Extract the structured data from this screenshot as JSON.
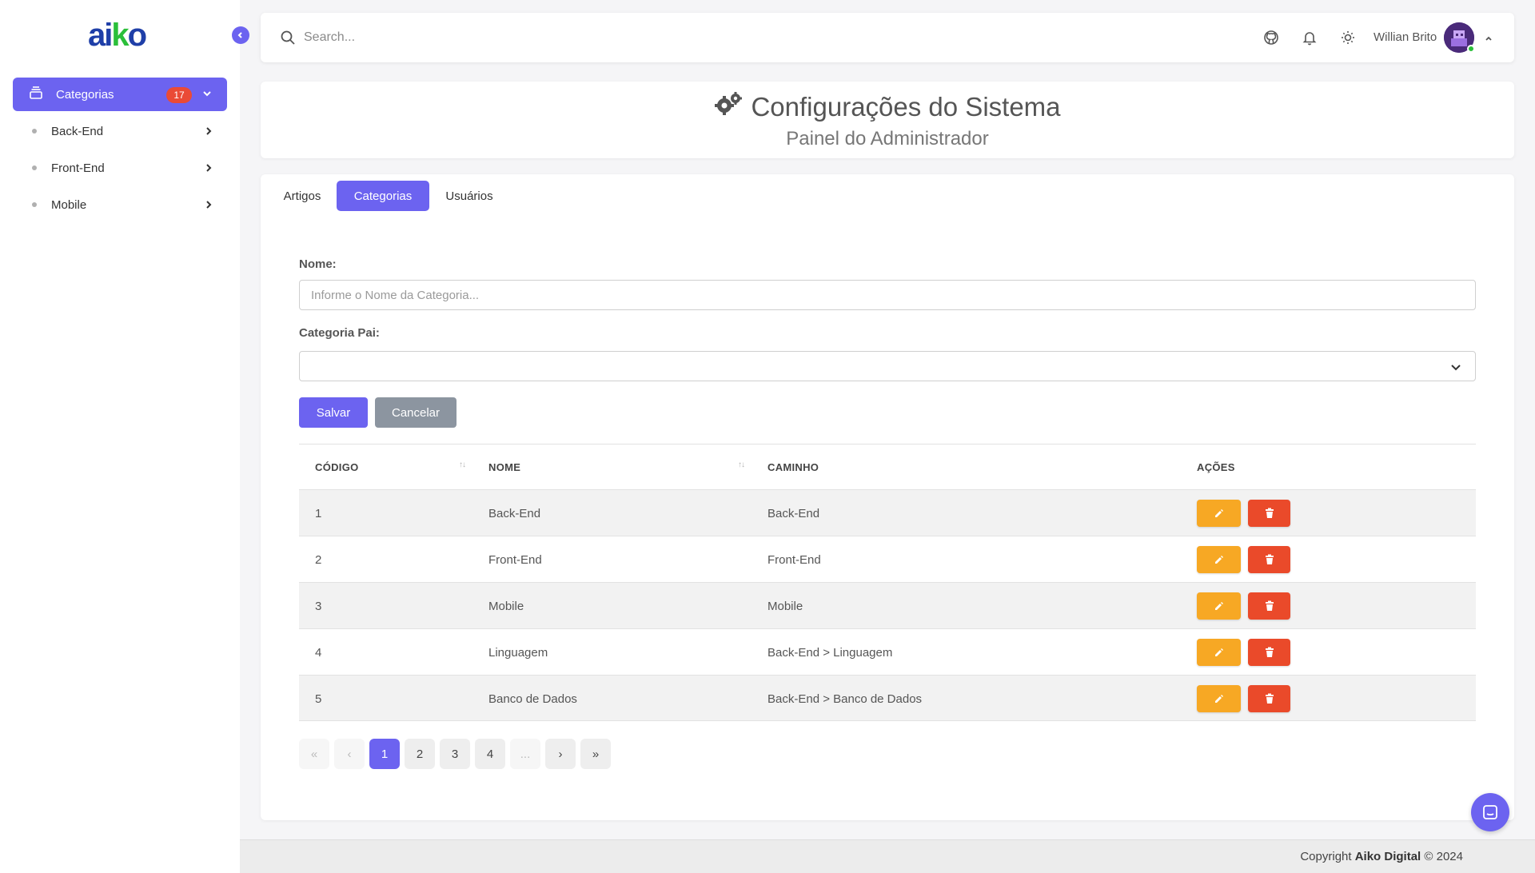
{
  "sidebar": {
    "logo_text": "aiko",
    "active_item": {
      "label": "Categorias",
      "badge": "17"
    },
    "items": [
      {
        "label": "Back-End"
      },
      {
        "label": "Front-End"
      },
      {
        "label": "Mobile"
      }
    ]
  },
  "topbar": {
    "search_placeholder": "Search...",
    "user_name": "Willian Brito"
  },
  "header": {
    "title": "Configurações do Sistema",
    "subtitle": "Painel do Administrador"
  },
  "tabs": [
    {
      "label": "Artigos",
      "active": false
    },
    {
      "label": "Categorias",
      "active": true
    },
    {
      "label": "Usuários",
      "active": false
    }
  ],
  "form": {
    "name_label": "Nome:",
    "name_placeholder": "Informe o Nome da Categoria...",
    "name_value": "",
    "parent_label": "Categoria Pai:",
    "parent_value": "",
    "save_label": "Salvar",
    "cancel_label": "Cancelar"
  },
  "table": {
    "headers": [
      "CÓDIGO",
      "NOME",
      "CAMINHO",
      "AÇÕES"
    ],
    "rows": [
      {
        "code": "1",
        "name": "Back-End",
        "path": "Back-End"
      },
      {
        "code": "2",
        "name": "Front-End",
        "path": "Front-End"
      },
      {
        "code": "3",
        "name": "Mobile",
        "path": "Mobile"
      },
      {
        "code": "4",
        "name": "Linguagem",
        "path": "Back-End > Linguagem"
      },
      {
        "code": "5",
        "name": "Banco de Dados",
        "path": "Back-End > Banco de Dados"
      }
    ]
  },
  "pagination": {
    "first": "«",
    "prev": "‹",
    "pages": [
      "1",
      "2",
      "3",
      "4"
    ],
    "current": "1",
    "ellipsis": "...",
    "next": "›",
    "last": "»"
  },
  "footer": {
    "prefix": "Copyright",
    "company": "Aiko Digital",
    "suffix": "© 2024"
  },
  "colors": {
    "accent": "#6c63f0",
    "badge": "#ea4a36",
    "edit": "#f7a824",
    "delete": "#ea4a2a",
    "cancel": "#8c95a0"
  },
  "icons": {
    "menu": "layers-icon",
    "search": "search-icon",
    "github": "github-icon",
    "bell": "bell-icon",
    "theme": "sun-icon",
    "edit": "pencil-icon",
    "delete": "trash-icon",
    "chat": "chat-icon",
    "title": "cogs-icon"
  }
}
